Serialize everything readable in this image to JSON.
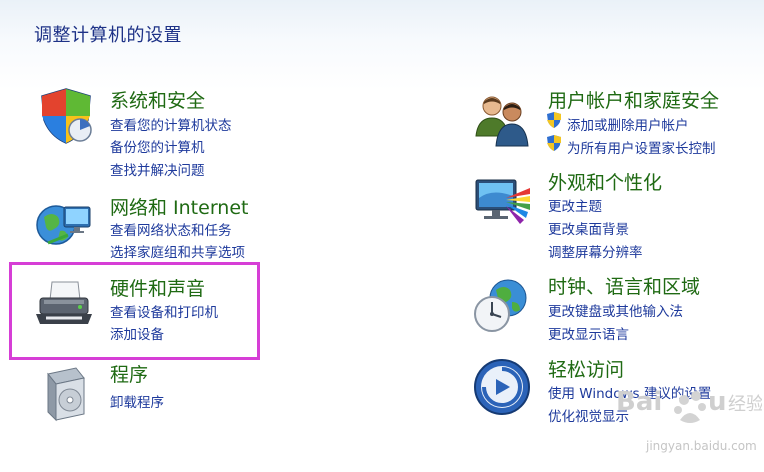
{
  "header": {
    "title": "调整计算机的设置"
  },
  "categories": {
    "system": {
      "title": "系统和安全",
      "icon": "shield-windows-icon",
      "links": [
        "查看您的计算机状态",
        "备份您的计算机",
        "查找并解决问题"
      ]
    },
    "network": {
      "title": "网络和 Internet",
      "icon": "globe-network-icon",
      "links": [
        "查看网络状态和任务",
        "选择家庭组和共享选项"
      ]
    },
    "hardware": {
      "title": "硬件和声音",
      "icon": "printer-icon",
      "links": [
        "查看设备和打印机",
        "添加设备"
      ]
    },
    "programs": {
      "title": "程序",
      "icon": "software-box-icon",
      "links": [
        "卸载程序"
      ]
    },
    "users": {
      "title": "用户帐户和家庭安全",
      "icon": "users-icon",
      "links": [
        "添加或删除用户帐户",
        "为所有用户设置家长控制"
      ]
    },
    "appearance": {
      "title": "外观和个性化",
      "icon": "monitor-palette-icon",
      "links": [
        "更改主题",
        "更改桌面背景",
        "调整屏幕分辨率"
      ]
    },
    "clock": {
      "title": "时钟、语言和区域",
      "icon": "clock-globe-icon",
      "links": [
        "更改键盘或其他输入法",
        "更改显示语言"
      ]
    },
    "ease": {
      "title": "轻松访问",
      "icon": "ease-of-access-icon",
      "links": [
        "使用 Windows 建议的设置",
        "优化视觉显示"
      ]
    }
  },
  "watermark": {
    "text": "Baidu 经验",
    "url": "jingyan.baidu.com"
  },
  "colors": {
    "title": "#1f6a13",
    "link": "#1e3a9c",
    "highlight": "#d63ed6",
    "heading": "#1e3287"
  }
}
